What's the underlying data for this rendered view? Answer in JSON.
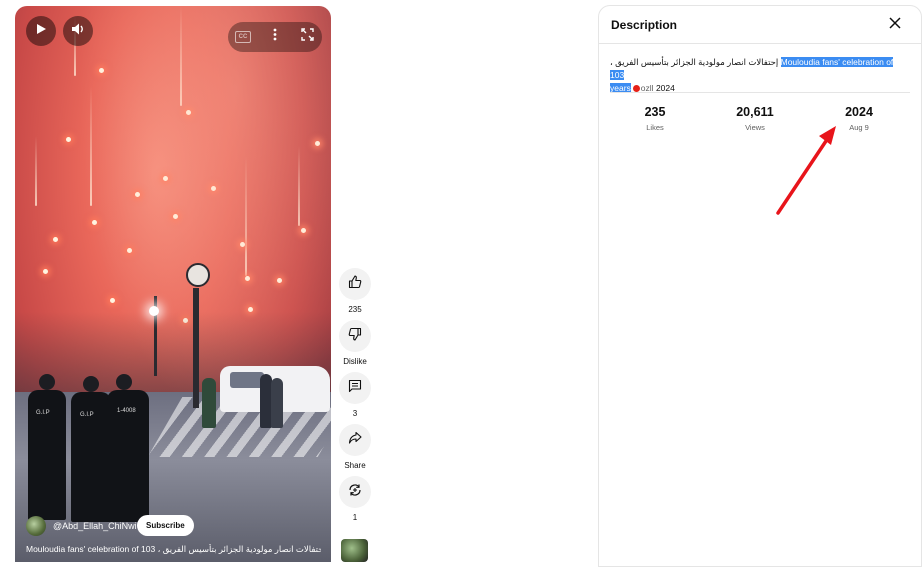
{
  "video": {
    "channel_name": "@Abd_Ellah_ChiNwi",
    "subscribe_label": "Subscribe",
    "title": "Mouloudia fans' celebration of 103 ، إحتفالات انصار مولودية الجزائر بتأسيس الفريق ...",
    "cc_label": "CC",
    "controls": {
      "play_icon": "play-icon",
      "volume_icon": "volume-icon",
      "captions_icon": "captions-icon",
      "more_icon": "more-vert-icon",
      "fullscreen_icon": "fullscreen-icon"
    },
    "police_text_1": "G.I.P",
    "police_text_2": "G.I.P",
    "police_text_3": "1-4008"
  },
  "actions": {
    "like_count": "235",
    "dislike_label": "Dislike",
    "comments_count": "3",
    "share_label": "Share",
    "remix_count": "1"
  },
  "description": {
    "title": "Description",
    "text_arabic": "، إحتفالات انصار مولودية الجزائر بتأسيس الفريق",
    "text_highlight_1": "Mouloudia fans' celebration of 103",
    "text_highlight_2": "years",
    "text_tail_label": "ozll",
    "text_year": "2024",
    "stats": [
      {
        "value": "235",
        "label": "Likes"
      },
      {
        "value": "20,611",
        "label": "Views"
      },
      {
        "value": "2024",
        "label": "Aug 9"
      }
    ]
  },
  "colors": {
    "highlight": "#3b8cf2",
    "annotation_arrow": "#e8141b",
    "live_dot": "#e62117"
  }
}
